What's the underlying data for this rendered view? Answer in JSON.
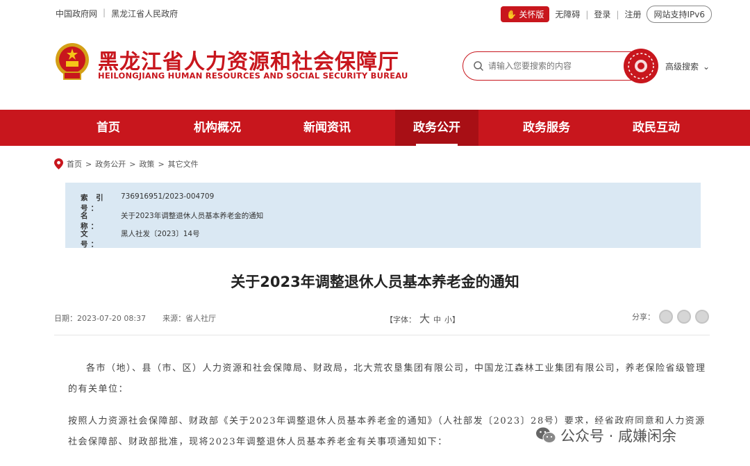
{
  "topbar": {
    "links": [
      "中国政府网",
      "黑龙江省人民政府"
    ],
    "care": "关怀版",
    "accessibility": "无障碍",
    "login": "登录",
    "register": "注册",
    "ipv6": "网站支持IPv6"
  },
  "header": {
    "title": "黑龙江省人力资源和社会保障厅",
    "subtitle": "HEILONGJIANG HUMAN RESOURCES AND SOCIAL SECURITY BUREAU",
    "search_placeholder": "请输入您要搜索的内容",
    "advanced_search": "高级搜索"
  },
  "colors": {
    "brand_red": "#c8161d",
    "info_bg": "#dae8f3"
  },
  "nav": {
    "items": [
      "首页",
      "机构概况",
      "新闻资讯",
      "政务公开",
      "政务服务",
      "政民互动"
    ],
    "active_index": 3
  },
  "breadcrumb": [
    "首页",
    "政务公开",
    "政策",
    "其它文件"
  ],
  "info": {
    "index_label": "索 引 号：",
    "index_value": "736916951/2023-004709",
    "name_label": "名　　称：",
    "name_value": "关于2023年调整退休人员基本养老金的通知",
    "doc_label": "文　　号：",
    "doc_value": "黑人社发〔2023〕14号"
  },
  "article": {
    "title": "关于2023年调整退休人员基本养老金的通知",
    "date": "日期：2023-07-20 08:37",
    "source": "来源：省人社厅",
    "font_label": "【字体：",
    "font_big": "大",
    "font_mid": "中",
    "font_small": "小】",
    "share_label": "分享：",
    "para1": "各市（地）、县（市、区）人力资源和社会保障局、财政局，北大荒农垦集团有限公司，中国龙江森林工业集团有限公司，养老保险省级管理的有关单位：",
    "para2": "按照人力资源社会保障部、财政部《关于2023年调整退休人员基本养老金的通知》（人社部发〔2023〕28号）要求，经省政府同意和人力资源社会保障部、财政部批准，现将2023年调整退休人员基本养老金有关事项通知如下："
  },
  "watermark": {
    "text": "公众号 · 咸嫌闲余"
  }
}
